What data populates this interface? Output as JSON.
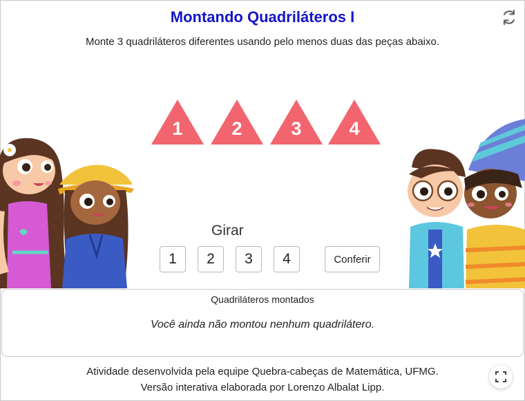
{
  "app": {
    "title": "Montando Quadriláteros I",
    "instruction": "Monte 3 quadriláteros diferentes usando pelo menos duas das peças abaixo."
  },
  "pieces": {
    "color": "#f2656f",
    "items": [
      {
        "label": "1"
      },
      {
        "label": "2"
      },
      {
        "label": "3"
      },
      {
        "label": "4"
      }
    ]
  },
  "rotate": {
    "label": "Girar",
    "buttons": [
      {
        "label": "1"
      },
      {
        "label": "2"
      },
      {
        "label": "3"
      },
      {
        "label": "4"
      }
    ]
  },
  "check_button": {
    "label": "Conferir"
  },
  "assembled": {
    "title": "Quadriláteros montados",
    "empty_message": "Você ainda não montou nenhum quadrilátero."
  },
  "footer": {
    "line1": "Atividade desenvolvida pela equipe Quebra-cabeças de Matemática, UFMG.",
    "line2": "Versão interativa elaborada por Lorenzo Albalat Lipp."
  },
  "icons": {
    "reset": "reset-icon",
    "fullscreen": "fullscreen-icon"
  },
  "colors": {
    "title": "#1414c8",
    "piece": "#f2656f",
    "border": "#c8c8c8"
  }
}
